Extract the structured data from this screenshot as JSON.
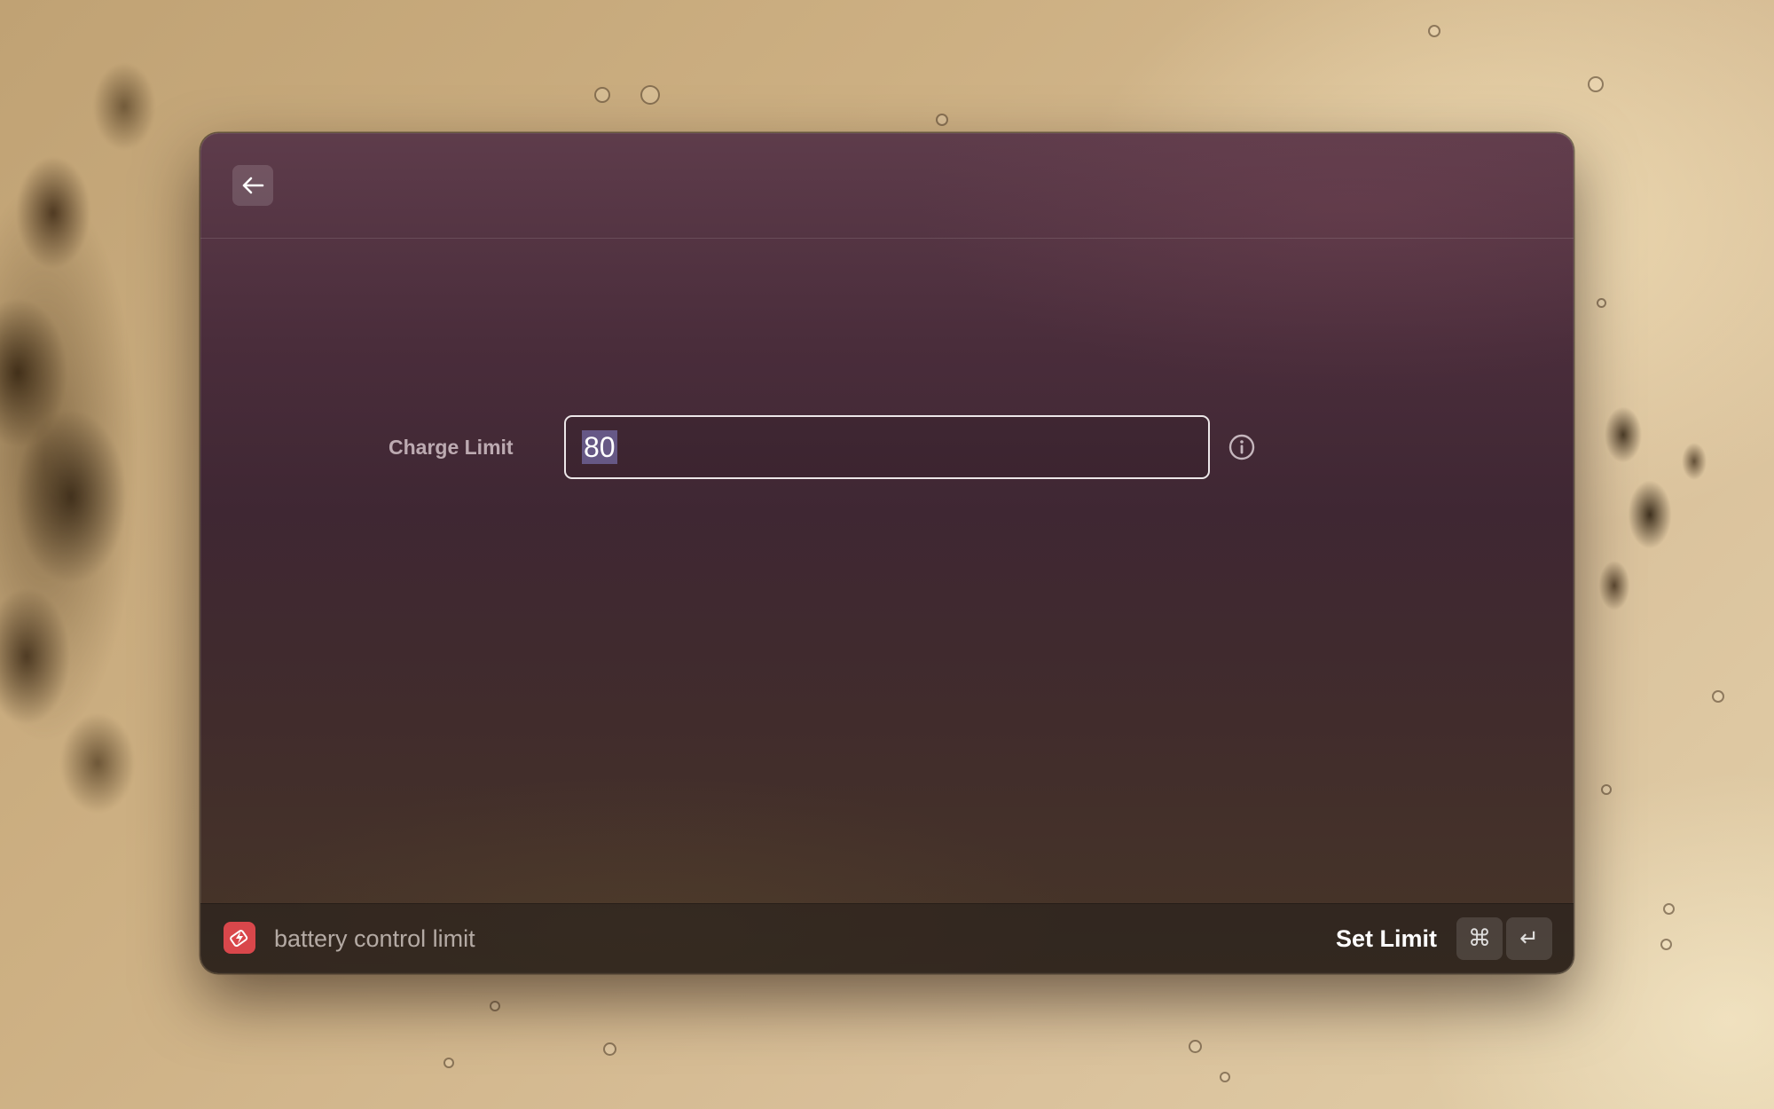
{
  "toolbar": {
    "back_icon": "arrow-left-icon"
  },
  "form": {
    "charge_limit_label": "Charge Limit",
    "charge_limit_value": "80",
    "info_icon": "info-icon"
  },
  "footer": {
    "extension_icon": "battery-extension-icon",
    "extension_color": "#d9474b",
    "title": "battery control limit",
    "action_label": "Set Limit",
    "shortcut_modifier": "⌘",
    "shortcut_key": "↵"
  }
}
